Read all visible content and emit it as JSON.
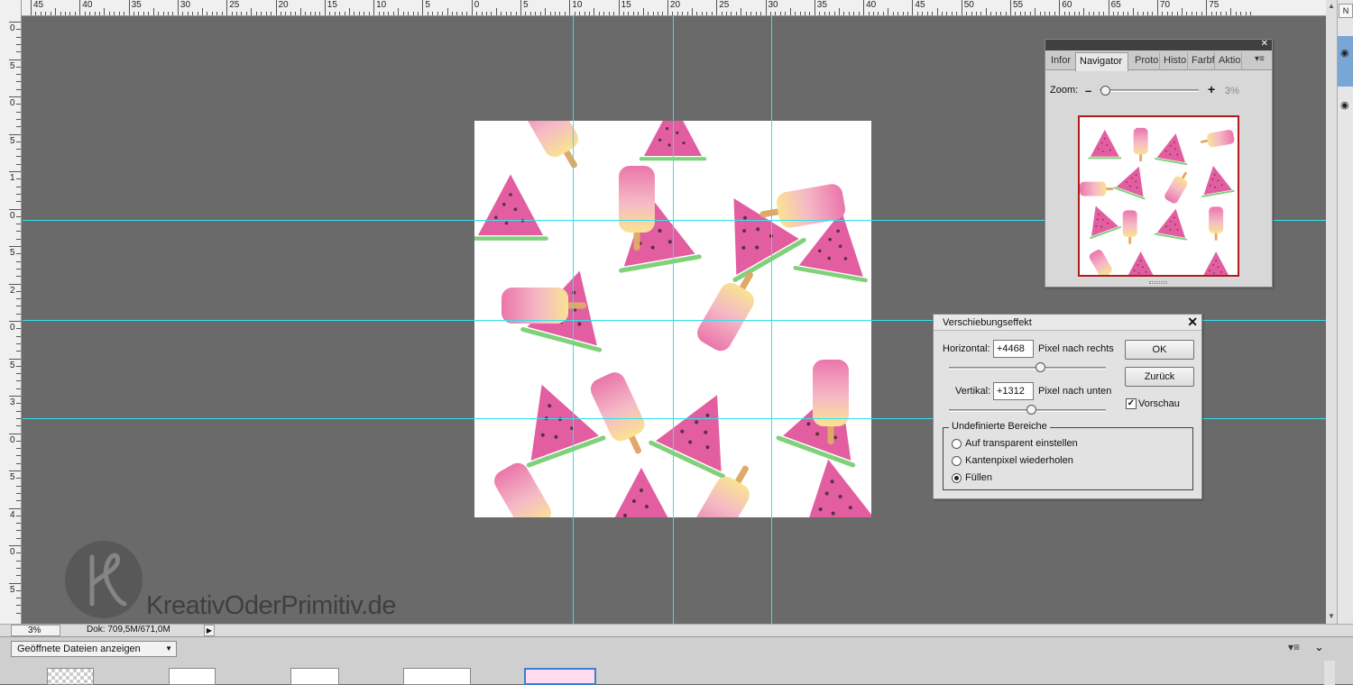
{
  "rulers": {
    "horizontal_labels": [
      "45",
      "40",
      "35",
      "30",
      "25",
      "20",
      "15",
      "10",
      "5",
      "0",
      "5",
      "10",
      "15",
      "20",
      "25",
      "30",
      "35",
      "40",
      "45",
      "50",
      "55",
      "60",
      "65",
      "70",
      "75"
    ],
    "vertical_labels": [
      "0",
      "5",
      "0",
      "5",
      "1",
      "0",
      "5",
      "2",
      "0",
      "5",
      "3",
      "0",
      "5",
      "4",
      "0",
      "5"
    ]
  },
  "status": {
    "zoom": "3%",
    "doc_info": "Dok: 709,5M/671,0M"
  },
  "bin": {
    "dropdown": "Geöffnete Dateien anzeigen"
  },
  "watermark": {
    "text": "KreativOderPrimitiv.de"
  },
  "right_strip": {
    "tab_label": "N"
  },
  "navigator": {
    "tabs": [
      "Infor",
      "Navigator",
      "Proto",
      "Histo",
      "Farbf",
      "Aktio"
    ],
    "active_tab": "Navigator",
    "zoom_label": "Zoom:",
    "zoom_value": "3%",
    "zoom_level_fraction": 0.03
  },
  "dialog": {
    "title": "Verschiebungseffekt",
    "horizontal_label": "Horizontal:",
    "horizontal_value": "+4468",
    "horizontal_unit": "Pixel nach rechts",
    "vertical_label": "Vertikal:",
    "vertical_value": "+1312",
    "vertical_unit": "Pixel nach unten",
    "ok": "OK",
    "cancel": "Zurück",
    "preview_label": "Vorschau",
    "preview_checked": true,
    "group_title": "Undefinierte Bereiche",
    "options": [
      "Auf transparent einstellen",
      "Kantenpixel wiederholen",
      "Füllen"
    ],
    "selected_option": "Füllen"
  },
  "colors": {
    "guide": "#33e0ee",
    "canvas_bg": "#6a6a6a",
    "watermelon": "#e25ea0",
    "rind": "#7fd17a",
    "popsicle_top": "#ea76ab",
    "popsicle_bottom": "#f9e392",
    "stick": "#e0a869"
  }
}
